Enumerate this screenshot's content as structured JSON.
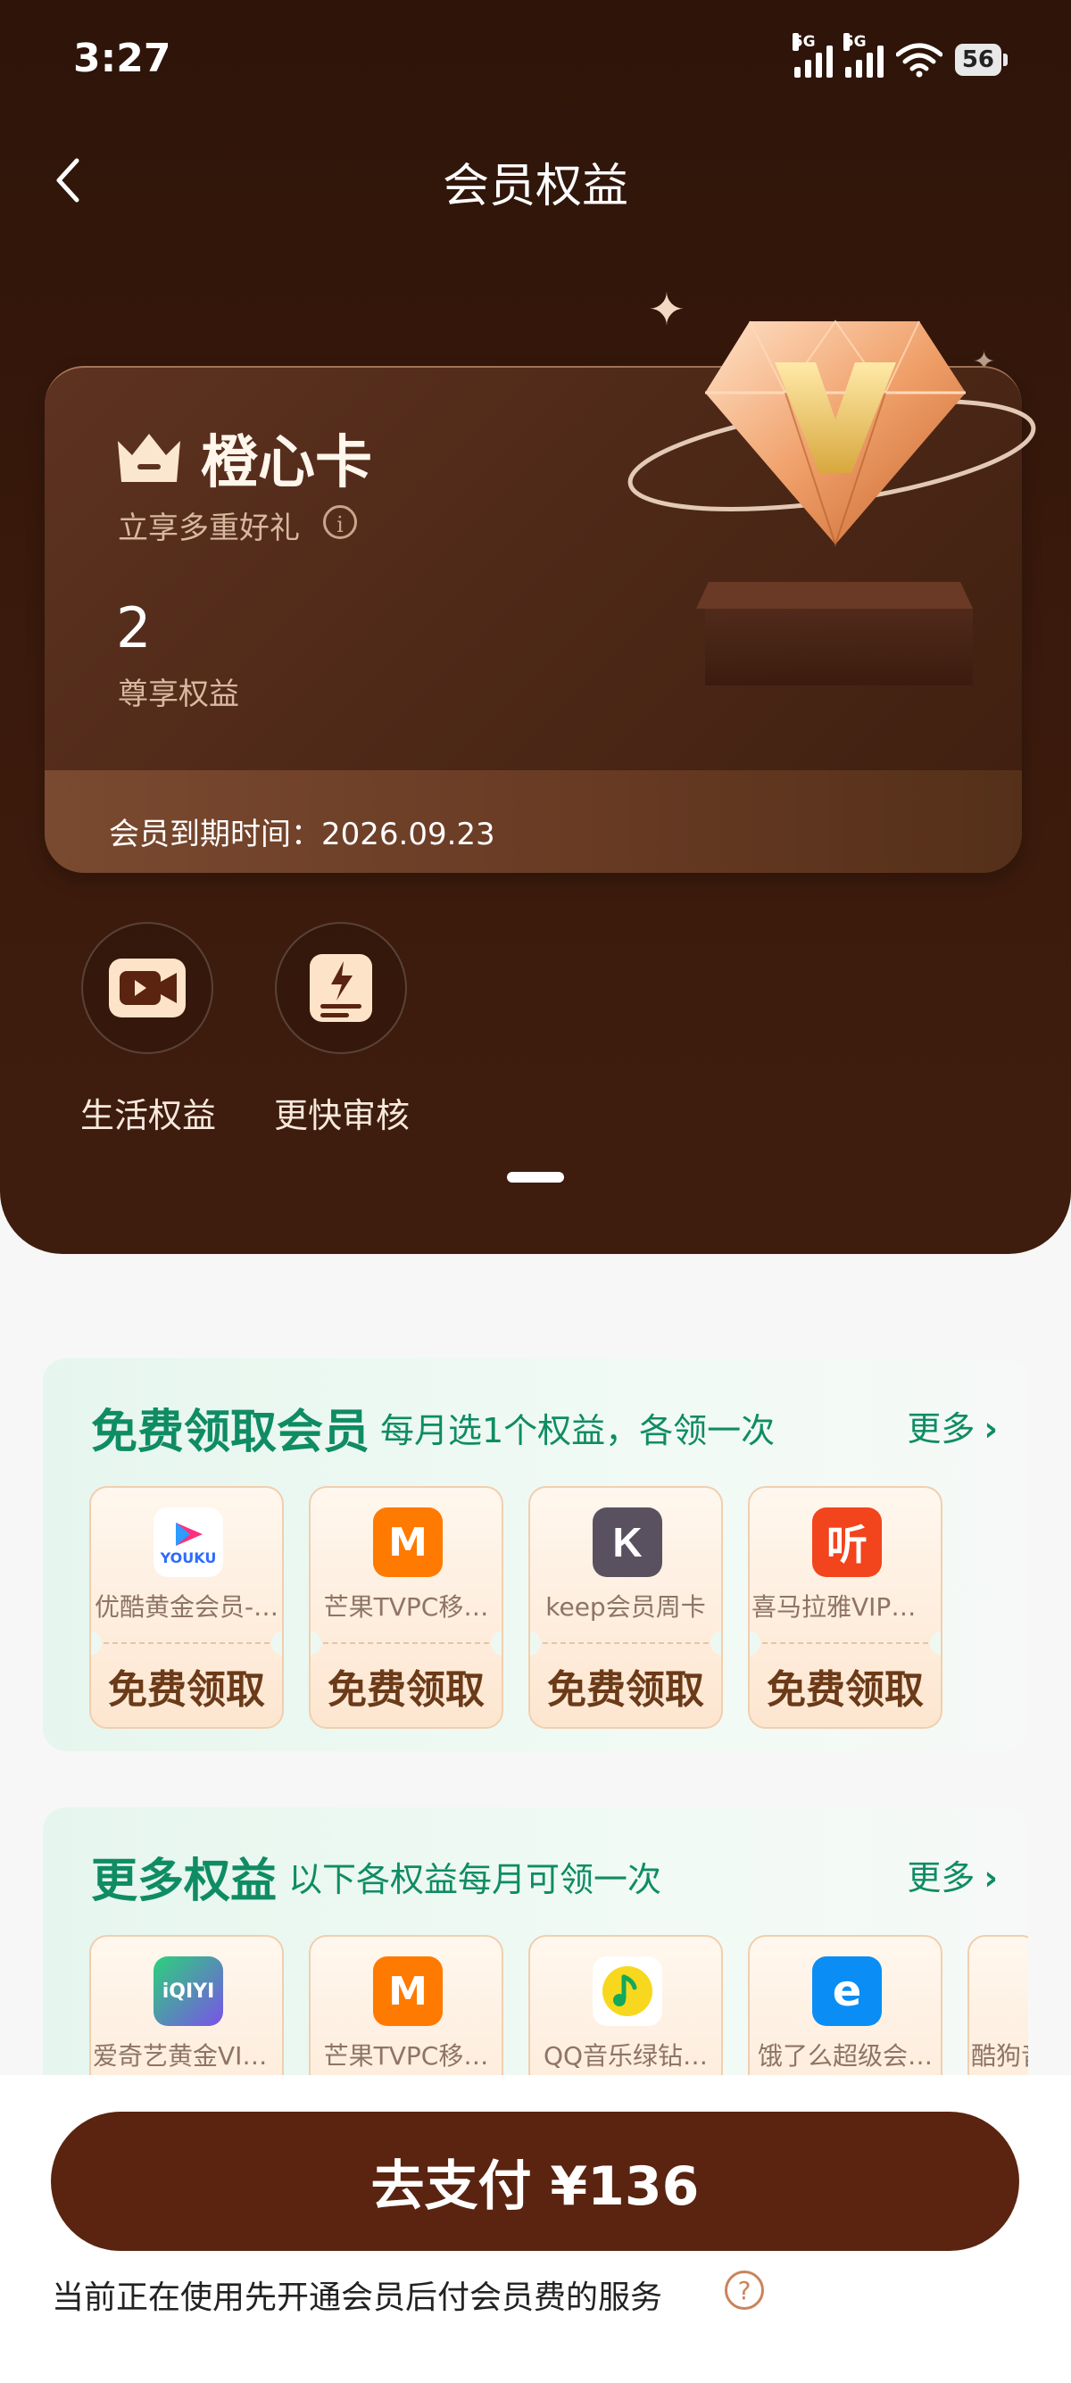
{
  "status": {
    "time": "3:27",
    "signal1": "5G",
    "signal2": "5G",
    "battery": "56"
  },
  "header": {
    "title": "会员权益"
  },
  "card": {
    "title": "橙心卡",
    "subtitle": "立享多重好礼",
    "count": "2",
    "count_label": "尊享权益",
    "expire": "会员到期时间：2026.09.23"
  },
  "benefits": [
    {
      "label": "生活权益",
      "icon": "video-icon"
    },
    {
      "label": "更快审核",
      "icon": "fast-review-icon"
    }
  ],
  "free_section": {
    "title": "免费领取会员",
    "subtitle": "每月选1个权益，各领一次",
    "more": "更多",
    "items": [
      {
        "name": "优酷黄金会员-…",
        "logo_text": "YOUKU",
        "claim": "免费领取"
      },
      {
        "name": "芒果TVPC移…",
        "logo_text": "M",
        "claim": "免费领取"
      },
      {
        "name": "keep会员周卡",
        "logo_text": "K",
        "claim": "免费领取"
      },
      {
        "name": "喜马拉雅VIP会…",
        "logo_text": "听",
        "claim": "免费领取"
      }
    ]
  },
  "more_section": {
    "title": "更多权益",
    "subtitle": "以下各权益每月可领一次",
    "more": "更多",
    "items": [
      {
        "name": "爱奇艺黄金VIP…",
        "logo_text": "iQIYI"
      },
      {
        "name": "芒果TVPC移…",
        "logo_text": "M"
      },
      {
        "name": "QQ音乐绿钻…",
        "logo_text": "♪"
      },
      {
        "name": "饿了么超级会…",
        "logo_text": "e"
      },
      {
        "name": "酷狗音",
        "logo_text": ""
      }
    ]
  },
  "footer": {
    "pay_label": "去支付 ¥136",
    "note": "当前正在使用先开通会员后付会员费的服务",
    "help": "?"
  },
  "colors": {
    "accent_green": "#0f8c64",
    "brown": "#5a2410"
  }
}
